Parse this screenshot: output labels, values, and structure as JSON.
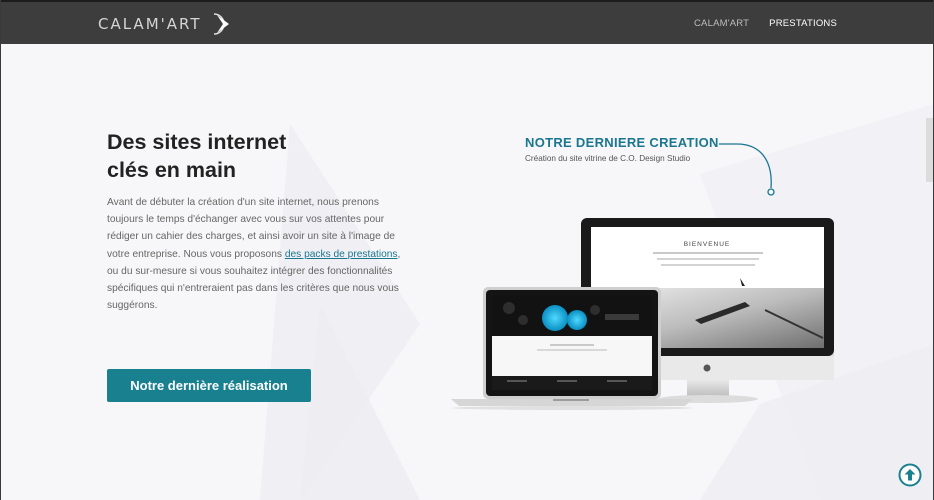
{
  "header": {
    "logo_text": "CALAM'ART",
    "nav": [
      {
        "label": "CALAM'ART"
      },
      {
        "label": "PRESTATIONS"
      }
    ]
  },
  "hero": {
    "title_line1": "Des sites internet",
    "title_line2": "clés en main",
    "text_before_link": "Avant de débuter la création d'un site internet, nous prenons toujours le temps d'échanger avec vous sur vos attentes pour rédiger un cahier des charges, et ainsi avoir un site à l'image de votre entreprise. Nous vous proposons ",
    "text_link": "des packs de prestations",
    "text_after_link": ", ou du sur-mesure si vous souhaitez intégrer des fonctionnalités spécifiques qui n'entreraient pas dans les critères que nous vous suggérons.",
    "cta_label": "Notre dernière réalisation"
  },
  "creation": {
    "title": "NOTRE DERNIERE CREATION",
    "subtitle": "Création du site vitrine de C.O. Design Studio",
    "screen_heading": "BIENVENUE"
  },
  "colors": {
    "accent": "#19808f",
    "link": "#1b7690",
    "header_bg": "#3d3d3d"
  },
  "icons": {
    "logo": "logo-mark-icon",
    "scroll_top": "arrow-up-circle-icon"
  }
}
